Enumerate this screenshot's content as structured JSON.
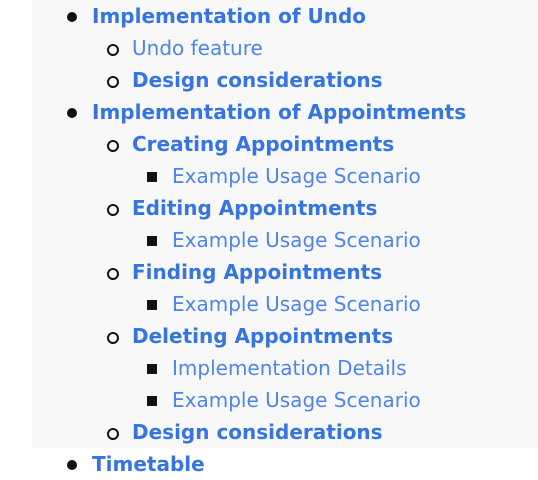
{
  "toc": {
    "undo": {
      "label": "Implementation of Undo",
      "children": {
        "feature": "Undo feature",
        "design": "Design considerations"
      }
    },
    "appointments": {
      "label": "Implementation of Appointments",
      "creating": {
        "label": "Creating Appointments",
        "usage": "Example Usage Scenario"
      },
      "editing": {
        "label": "Editing Appointments",
        "usage": "Example Usage Scenario"
      },
      "finding": {
        "label": "Finding Appointments",
        "usage": "Example Usage Scenario"
      },
      "deleting": {
        "label": "Deleting Appointments",
        "details": "Implementation Details",
        "usage": "Example Usage Scenario"
      },
      "design": "Design considerations"
    },
    "timetable": {
      "label": "Timetable"
    }
  }
}
